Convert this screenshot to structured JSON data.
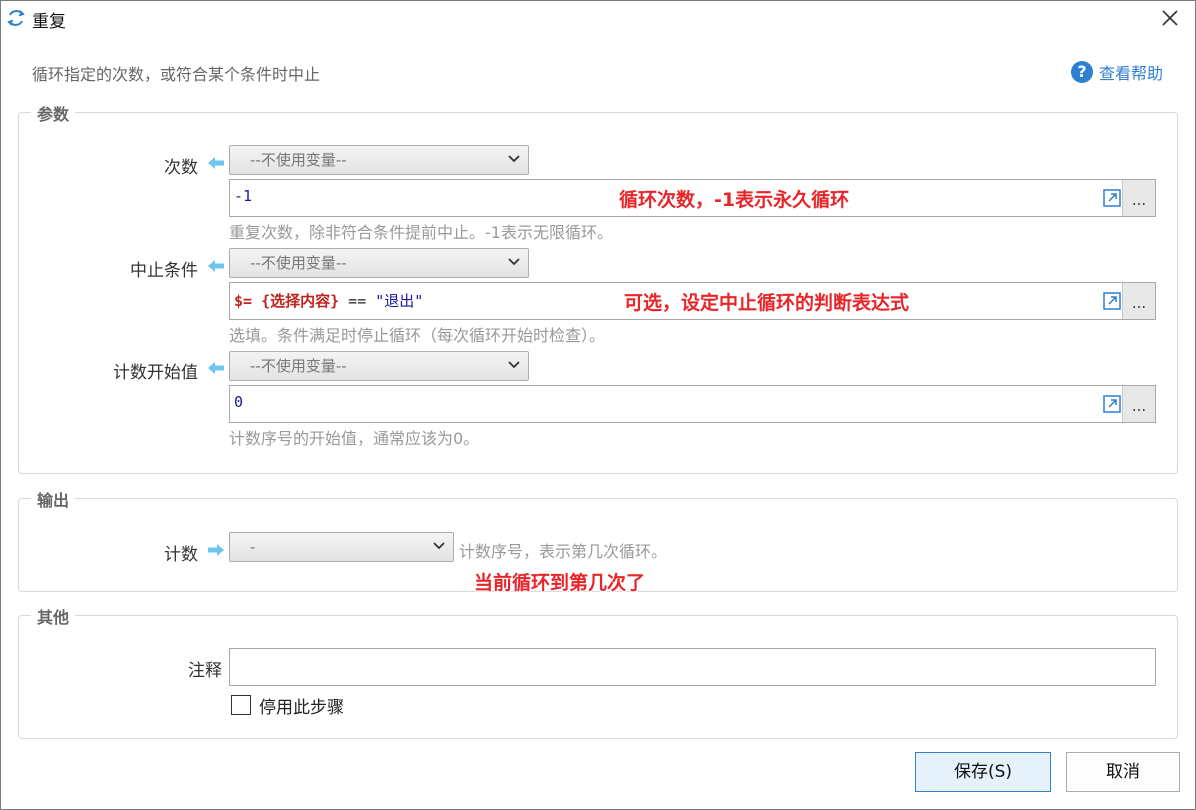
{
  "window": {
    "title": "重复",
    "icon": "repeat-icon",
    "close_icon": "close-icon"
  },
  "description": "循环指定的次数，或符合某个条件时中止",
  "help": {
    "label": "查看帮助",
    "icon": "help-icon",
    "icon_glyph": "?"
  },
  "params": {
    "title": "参数",
    "count": {
      "label": "次数",
      "var_select": "--不使用变量--",
      "value": "-1",
      "hint": "重复次数，除非符合条件提前中止。-1表示无限循环。",
      "annotation": "循环次数，-1表示永久循环"
    },
    "stop_condition": {
      "label": "中止条件",
      "var_select": "--不使用变量--",
      "value_parts": [
        "$= ",
        "{选择内容}",
        " == ",
        "\"退出\""
      ],
      "hint": "选填。条件满足时停止循环（每次循环开始时检查）。",
      "annotation": "可选，设定中止循环的判断表达式"
    },
    "start_value": {
      "label": "计数开始值",
      "var_select": "--不使用变量--",
      "value": "0",
      "hint": "计数序号的开始值，通常应该为0。"
    },
    "more_button": "..."
  },
  "output": {
    "title": "输出",
    "counter": {
      "label": "计数",
      "select": "-",
      "hint": "计数序号，表示第几次循环。",
      "annotation": "当前循环到第几次了"
    }
  },
  "other": {
    "title": "其他",
    "note_label": "注释",
    "note_value": "",
    "disable_label": "停用此步骤",
    "disable_checked": false
  },
  "buttons": {
    "save": "保存(S)",
    "cancel": "取消"
  },
  "colors": {
    "accent": "#2f7fd1",
    "annotation": "#e8262a",
    "arrow": "#6ec6f0"
  }
}
